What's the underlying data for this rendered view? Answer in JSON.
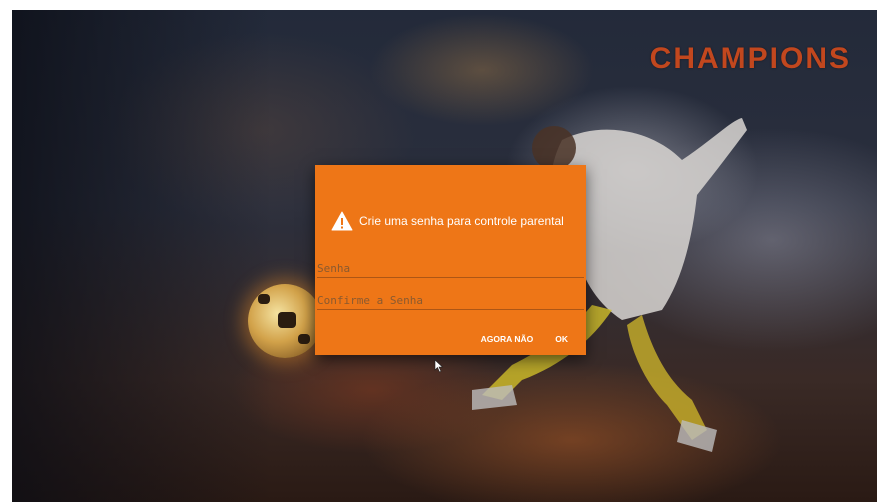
{
  "app": {
    "logo_text": "CHAMPIONS"
  },
  "dialog": {
    "title": "Crie uma senha para controle parental",
    "icon": "warning-triangle-icon",
    "password_field": {
      "placeholder": "Senha",
      "value": ""
    },
    "confirm_field": {
      "placeholder": "Confirme a Senha",
      "value": ""
    },
    "buttons": {
      "cancel_label": "AGORA NÃO",
      "ok_label": "OK"
    }
  },
  "colors": {
    "dialog_background": "#ee7617",
    "logo": "#c2471e",
    "text_on_dialog": "#ffffff"
  }
}
